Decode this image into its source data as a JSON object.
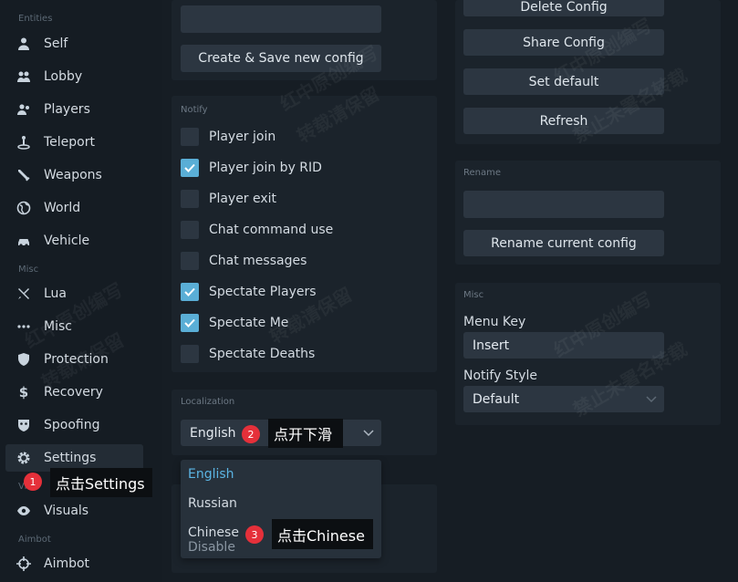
{
  "sidebar": {
    "sections": {
      "entities": "Entities",
      "misc": "Misc",
      "visuals_partial": "Vi",
      "aimbot": "Aimbot"
    },
    "items": [
      {
        "label": "Self",
        "icon": "person-icon"
      },
      {
        "label": "Lobby",
        "icon": "people-icon"
      },
      {
        "label": "Players",
        "icon": "group-icon"
      },
      {
        "label": "Teleport",
        "icon": "teleport-icon"
      },
      {
        "label": "Weapons",
        "icon": "weapon-icon"
      },
      {
        "label": "World",
        "icon": "globe-icon"
      },
      {
        "label": "Vehicle",
        "icon": "car-icon"
      },
      {
        "label": "Lua",
        "icon": "tools-icon"
      },
      {
        "label": "Misc",
        "icon": "dots-icon"
      },
      {
        "label": "Protection",
        "icon": "shield-icon"
      },
      {
        "label": "Recovery",
        "icon": "dollar-icon"
      },
      {
        "label": "Spoofing",
        "icon": "mask-icon"
      },
      {
        "label": "Settings",
        "icon": "gear-icon"
      },
      {
        "label": "Visuals",
        "icon": "eye-icon"
      },
      {
        "label": "Aimbot",
        "icon": "crosshair-icon"
      }
    ]
  },
  "config": {
    "create_save_label": "Create & Save new config",
    "delete_label": "Delete Config",
    "share_label": "Share Config",
    "set_default_label": "Set default",
    "refresh_label": "Refresh"
  },
  "notify": {
    "title": "Notify",
    "options": [
      {
        "label": "Player join",
        "checked": false
      },
      {
        "label": "Player join by RID",
        "checked": true
      },
      {
        "label": "Player exit",
        "checked": false
      },
      {
        "label": "Chat command use",
        "checked": false
      },
      {
        "label": "Chat messages",
        "checked": false
      },
      {
        "label": "Spectate Players",
        "checked": true
      },
      {
        "label": "Spectate Me",
        "checked": true
      },
      {
        "label": "Spectate Deaths",
        "checked": false
      }
    ]
  },
  "rename": {
    "title": "Rename",
    "button_label": "Rename current config"
  },
  "misc": {
    "title": "Misc",
    "menu_key_label": "Menu Key",
    "menu_key_value": "Insert",
    "notify_style_label": "Notify Style",
    "notify_style_value": "Default"
  },
  "localization": {
    "title": "Localization",
    "selected": "English",
    "options": [
      "English",
      "Russian",
      "Chinese"
    ],
    "hidden_partial": "Disable"
  },
  "annotations": [
    {
      "number": "1",
      "text": "点击Settings"
    },
    {
      "number": "2",
      "text": "点开下滑"
    },
    {
      "number": "3",
      "text": "点击Chinese"
    }
  ],
  "watermarks": [
    "红中原创编写",
    "转载请保留",
    "禁止未署名转载"
  ],
  "colors": {
    "accent": "#5aaed6",
    "badge": "#e5303a",
    "panel": "#1b232b",
    "control": "#2c3641"
  }
}
